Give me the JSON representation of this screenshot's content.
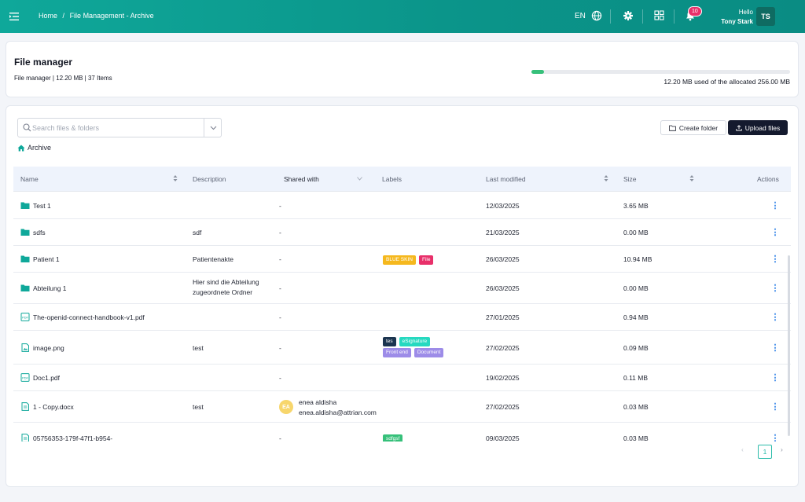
{
  "header": {
    "breadcrumb": [
      "Home",
      "/",
      "File Management - Archive"
    ],
    "language": "EN",
    "notifications_count": "10",
    "greeting": "Hello",
    "user_name": "Tony Stark",
    "user_initials": "TS"
  },
  "summary": {
    "title": "File manager",
    "subtitle": "File manager | 12.20 MB | 37 Items",
    "storage_text": "12.20 MB used of the allocated 256.00 MB",
    "storage_used_fraction": 0.048
  },
  "toolbar": {
    "search_placeholder": "Search files & folders",
    "create_folder_label": "Create folder",
    "upload_label": "Upload files",
    "current_folder": "Archive"
  },
  "table": {
    "columns": {
      "name": "Name",
      "description": "Description",
      "shared": "Shared with",
      "labels": "Labels",
      "modified": "Last modified",
      "size": "Size",
      "actions": "Actions"
    },
    "rows": [
      {
        "type": "folder",
        "name": "Test 1",
        "description": "",
        "shared": "-",
        "labels": [],
        "modified": "12/03/2025",
        "size": "3.65 MB"
      },
      {
        "type": "folder",
        "name": "sdfs",
        "description": "sdf",
        "shared": "-",
        "labels": [],
        "modified": "21/03/2025",
        "size": "0.00 MB"
      },
      {
        "type": "folder",
        "name": "Patient 1",
        "description": "Patientenakte",
        "shared": "-",
        "labels": [
          {
            "text": "BLUE SKIN",
            "color": "#f5b81e"
          },
          {
            "text": "File",
            "color": "#e8306a"
          }
        ],
        "modified": "26/03/2025",
        "size": "10.94 MB"
      },
      {
        "type": "folder",
        "name": "Abteilung 1",
        "description": "Hier sind die Abteilung zugeordnete Ordner",
        "shared": "-",
        "labels": [],
        "modified": "26/03/2025",
        "size": "0.00 MB"
      },
      {
        "type": "pdf",
        "name": "The-openid-connect-handbook-v1.pdf",
        "description": "",
        "shared": "-",
        "labels": [],
        "modified": "27/01/2025",
        "size": "0.94 MB"
      },
      {
        "type": "image",
        "name": "image.png",
        "description": "test",
        "shared": "-",
        "labels": [
          {
            "text": "tes",
            "color": "#1c3550"
          },
          {
            "text": "eSignature",
            "color": "#27d9c0"
          },
          {
            "text": "Front end",
            "color": "#9d8ce8"
          },
          {
            "text": "Document",
            "color": "#9d8ce8"
          }
        ],
        "modified": "27/02/2025",
        "size": "0.09 MB"
      },
      {
        "type": "pdf",
        "name": "Doc1.pdf",
        "description": "",
        "shared": "-",
        "labels": [],
        "modified": "19/02/2025",
        "size": "0.11 MB"
      },
      {
        "type": "doc",
        "name": "1 - Copy.docx",
        "description": "test",
        "shared_user": {
          "initials": "EA",
          "name": "enea aldisha",
          "email": "enea.aldisha@attrian.com"
        },
        "labels": [],
        "modified": "27/02/2025",
        "size": "0.03 MB"
      },
      {
        "type": "doc",
        "name": "05756353-179f-47f1-b954-",
        "description": "",
        "shared": "-",
        "labels": [
          {
            "text": "sdfgsf",
            "color": "#36c07a"
          }
        ],
        "modified": "09/03/2025",
        "size": "0.03 MB"
      }
    ]
  },
  "pagination": {
    "prev": "‹",
    "page": "1",
    "next": "›"
  },
  "colors": {
    "brand": "#0fa89a",
    "folder": "#0fa89a",
    "action": "#2b7fe6",
    "dark_button": "#141a2e"
  }
}
